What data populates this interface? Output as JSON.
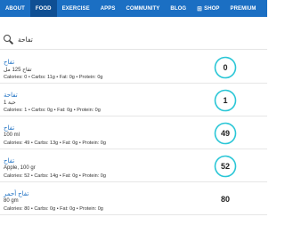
{
  "nav": {
    "items": [
      {
        "key": "about",
        "label": "ABOUT",
        "active": false
      },
      {
        "key": "food",
        "label": "FOOD",
        "active": true
      },
      {
        "key": "exercise",
        "label": "EXERCISE",
        "active": false
      },
      {
        "key": "apps",
        "label": "APPS",
        "active": false
      },
      {
        "key": "community",
        "label": "COMMUNITY",
        "active": false
      },
      {
        "key": "blog",
        "label": "BLOG",
        "active": false
      },
      {
        "key": "shop",
        "label": "SHOP",
        "active": false
      },
      {
        "key": "premium",
        "label": "PREMIUM",
        "active": false
      }
    ],
    "bg_color": "#1b6fc3",
    "active_color": "#0f4f93"
  },
  "search": {
    "value": "تفاحة",
    "icon": "search-icon"
  },
  "foods": [
    {
      "name": "تفاح",
      "serving": "تفاح 125 مل",
      "macros": "Calories: 0  •  Carbs: 11g  •  Fat: 0g  •  Protein: 0g",
      "score": "0",
      "ring": true
    },
    {
      "name": "تفاحة",
      "serving": "حبة 1",
      "macros": "Calories: 1  •  Carbs: 0g  •  Fat: 0g  •  Protein: 0g",
      "score": "1",
      "ring": true
    },
    {
      "name": "تفاح",
      "serving": "100 ml",
      "macros": "Calories: 49  •  Carbs: 13g  •  Fat: 0g  •  Protein: 0g",
      "score": "49",
      "ring": true
    },
    {
      "name": "تفاح",
      "serving": "Apple, 100 gr",
      "macros": "Calories: 52  •  Carbs: 14g  •  Fat: 0g  •  Protein: 0g",
      "score": "52",
      "ring": true
    },
    {
      "name": "تفاح أحمر",
      "serving": "80 gm",
      "macros": "Calories: 80  •  Carbs: 0g  •  Fat: 0g  •  Protein: 0g",
      "score": "80",
      "ring": false
    }
  ],
  "ring_color": "#29c6d6"
}
